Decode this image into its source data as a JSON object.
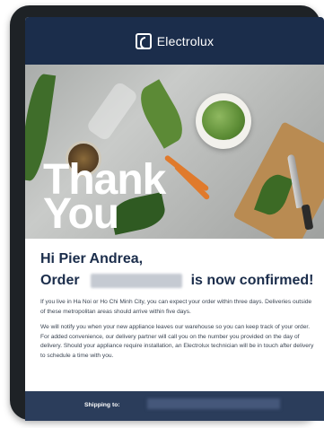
{
  "header": {
    "brand": "Electrolux",
    "logo_icon": "electrolux-logo-icon"
  },
  "hero": {
    "line1": "Thank",
    "line2": "You"
  },
  "message": {
    "greeting": "Hi Pier Andrea,",
    "order_prefix": "Order",
    "order_suffix": "is now confirmed!",
    "paragraph1": "If you live in Ha Noi or Ho Chi Minh City, you can expect your order within three days. Deliveries outside of these metropolitan areas should arrive within five days.",
    "paragraph2": "We will notify you when your new appliance leaves our warehouse so you can keep track of your order.",
    "paragraph3": "For added convenience, our delivery partner will call you on the number you provided on the day of delivery. Should your appliance require installation, an Electrolux technician will be in touch after delivery to schedule a time with you."
  },
  "shipping": {
    "label": "Shipping to:"
  },
  "colors": {
    "header_bg": "#1b2d4b",
    "heading": "#1b2d4b",
    "shipping_bg": "#2b3d5b"
  }
}
